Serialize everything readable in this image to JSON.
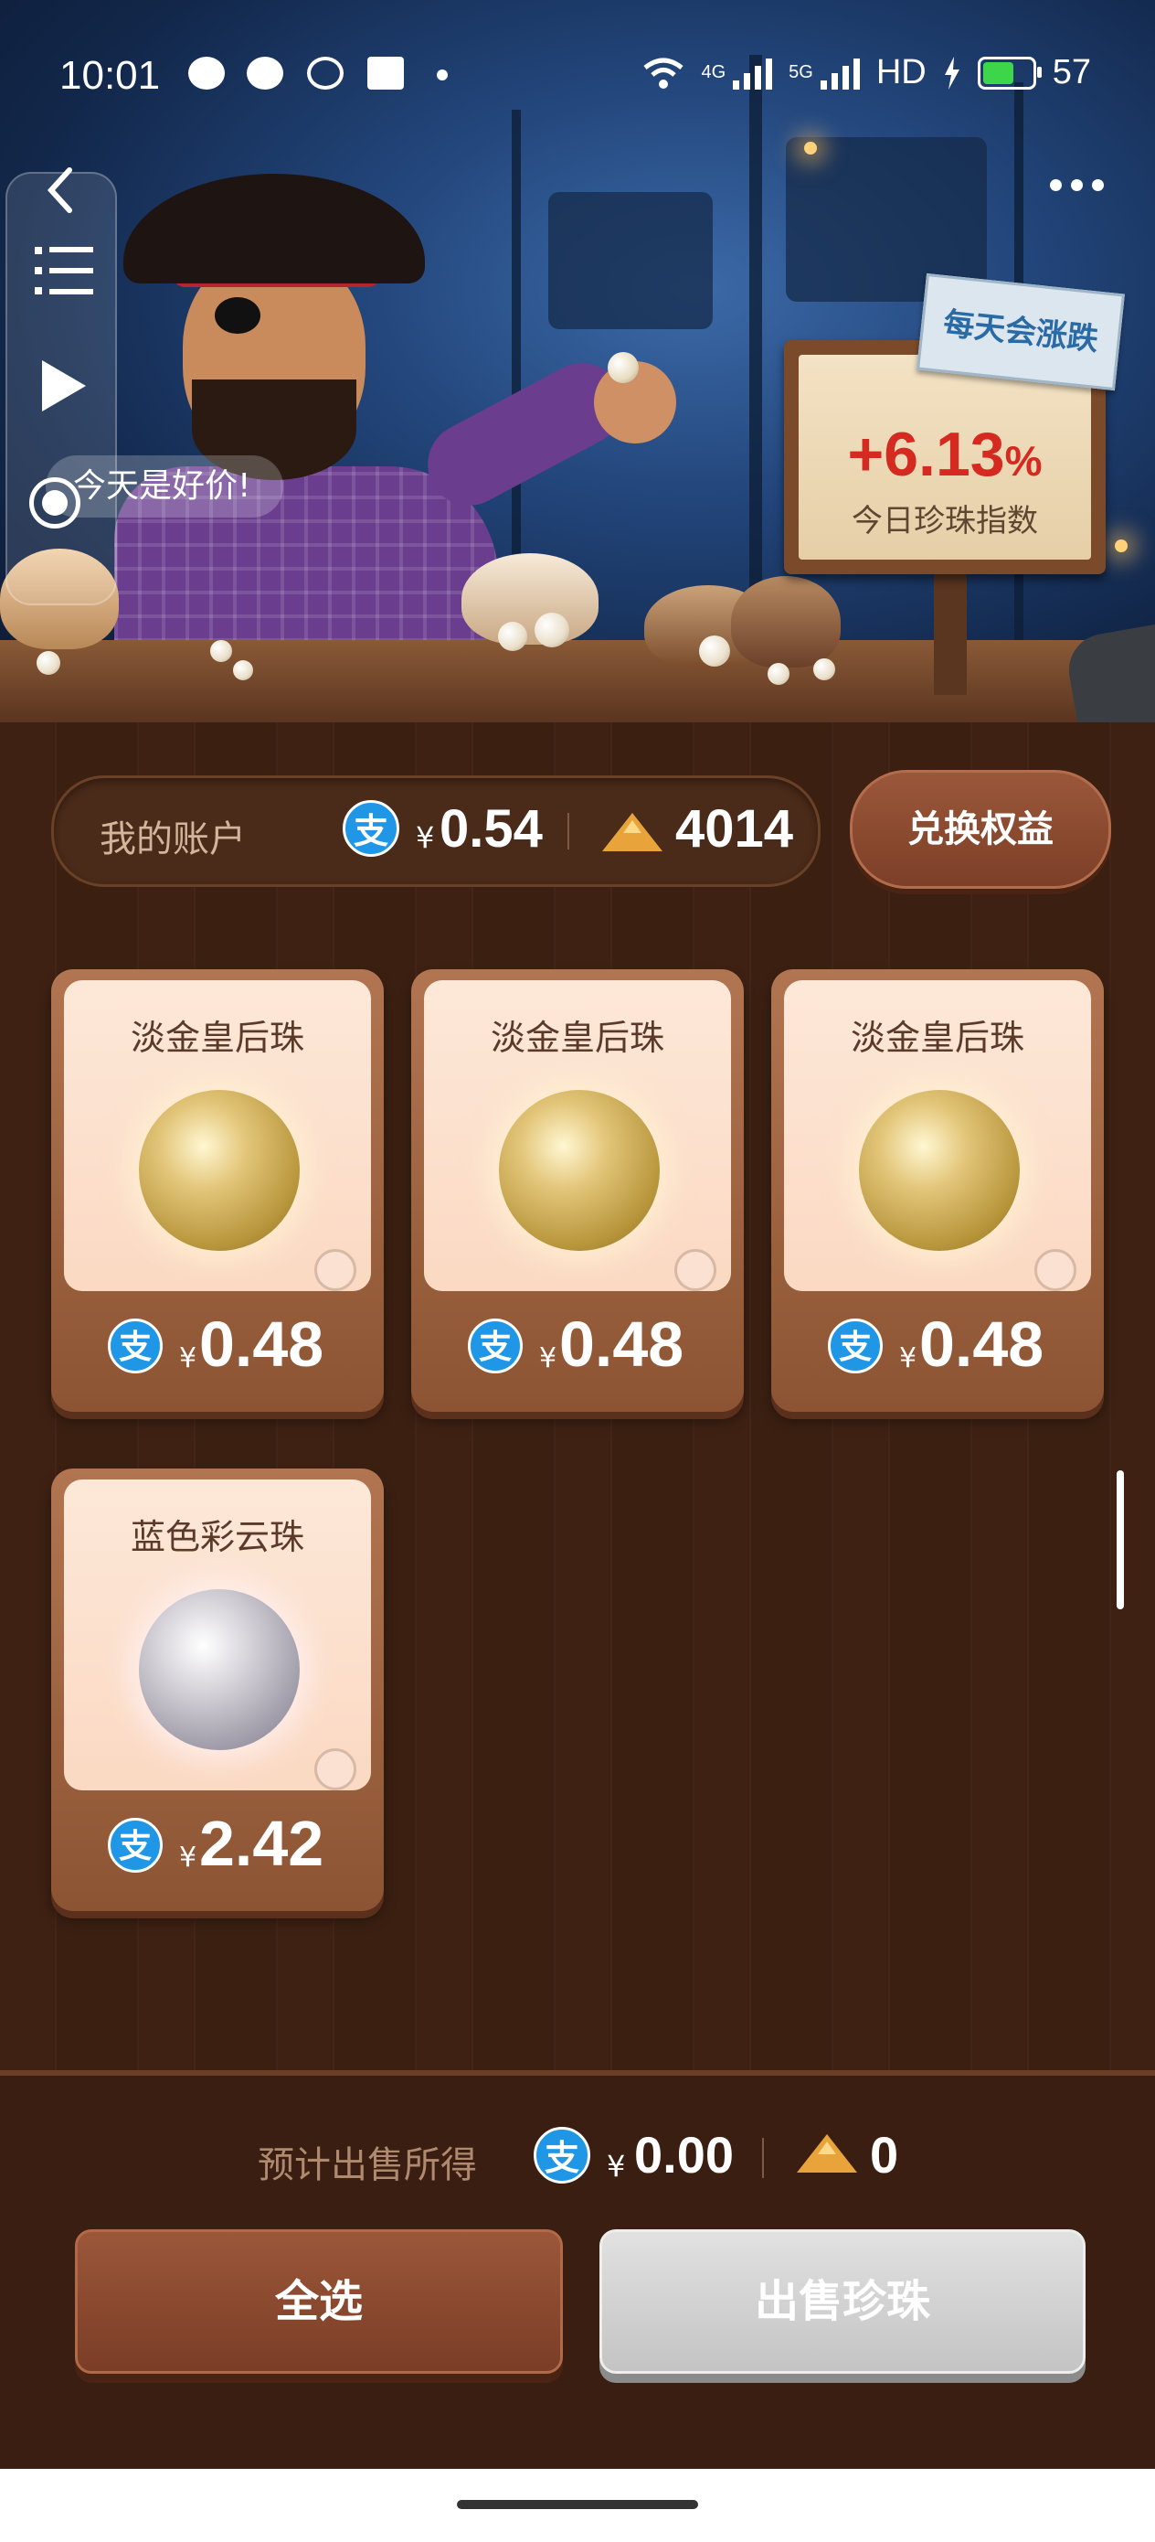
{
  "status_bar": {
    "time": "10:01",
    "network_4g": "4G",
    "network_5g": "5G",
    "hd": "HD",
    "battery": "57"
  },
  "hero": {
    "hint_text": "今天是好价!",
    "sign_tag": "每天会涨跌",
    "index_change": "+6.13",
    "index_unit": "%",
    "index_label": "今日珍珠指数"
  },
  "account": {
    "label": "我的账户",
    "alipay_icon": "支",
    "yen": "¥",
    "balance": "0.54",
    "points": "4014",
    "exchange_label": "兑换权益"
  },
  "pearls": [
    {
      "name": "淡金皇后珠",
      "type": "gold",
      "price": "0.48"
    },
    {
      "name": "淡金皇后珠",
      "type": "gold",
      "price": "0.48"
    },
    {
      "name": "淡金皇后珠",
      "type": "gold",
      "price": "0.48"
    },
    {
      "name": "蓝色彩云珠",
      "type": "silver",
      "price": "2.42"
    }
  ],
  "footer": {
    "estimate_label": "预计出售所得",
    "estimate_yen": "¥",
    "estimate_amount": "0.00",
    "estimate_points": "0",
    "select_all_label": "全选",
    "sell_label": "出售珍珠"
  },
  "colors": {
    "alipay_blue": "#1f97e6",
    "index_red": "#d42a20",
    "wood_dark": "#3e2113",
    "button_brown": "#8a4a30",
    "button_disabled": "#cfcfcf"
  }
}
